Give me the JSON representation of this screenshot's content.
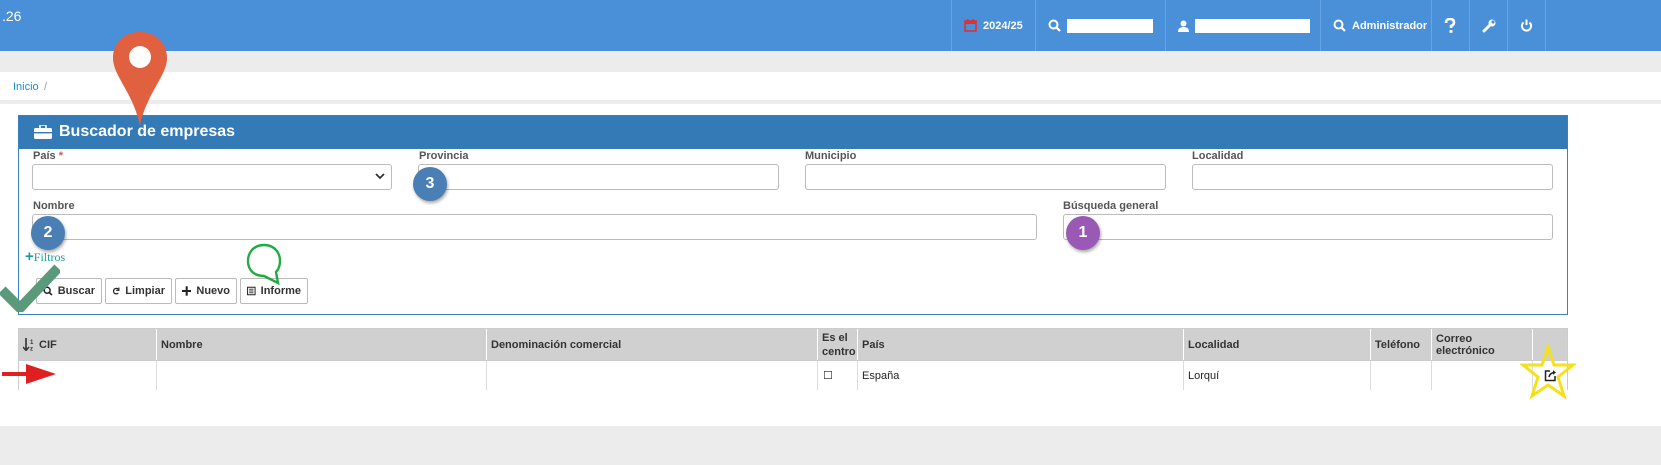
{
  "topbar": {
    "version": ".26",
    "year": "2024/25",
    "role": "Administrador"
  },
  "breadcrumb": {
    "home": "Inicio",
    "separator": "/"
  },
  "panel": {
    "title": "Buscador de empresas",
    "fields": {
      "pais": {
        "label": "País",
        "required_mark": "*"
      },
      "provincia": {
        "label": "Provincia"
      },
      "municipio": {
        "label": "Municipio"
      },
      "localidad": {
        "label": "Localidad"
      },
      "nombre": {
        "label": "Nombre"
      },
      "busqueda": {
        "label": "Búsqueda general"
      }
    },
    "filters_link": {
      "plus": "+",
      "label": "Filtros"
    },
    "buttons": {
      "buscar": "Buscar",
      "limpiar": "Limpiar",
      "nuevo": "Nuevo",
      "informe": "Informe"
    }
  },
  "table": {
    "sort_icon": "sort-alpha-asc-icon",
    "headers": {
      "cif": "CIF",
      "nombre": "Nombre",
      "denominacion": "Denominación comercial",
      "es_centro_1": "Es el",
      "es_centro_2": "centro",
      "pais": "País",
      "localidad": "Localidad",
      "telefono": "Teléfono",
      "correo": "Correo electrónico"
    },
    "rows": [
      {
        "cif": "",
        "nombre": "",
        "denominacion": "",
        "es_centro": "☐",
        "pais": "España",
        "localidad": "Lorquí",
        "telefono": "",
        "correo": ""
      }
    ]
  },
  "annotations": {
    "markers": [
      "1",
      "2",
      "3"
    ],
    "colors": {
      "marker1": "#9b59b6",
      "marker2": "#4a7fb5",
      "marker3": "#4a7fb5",
      "pin": "#e0603f",
      "check": "#5a9a7a",
      "bubble": "#22aa44",
      "star": "#f5e11a",
      "arrow": "#e02020"
    }
  },
  "colors": {
    "topbar": "#4a90d9",
    "panel_header": "#337ab7",
    "link": "#1f8fc9"
  }
}
